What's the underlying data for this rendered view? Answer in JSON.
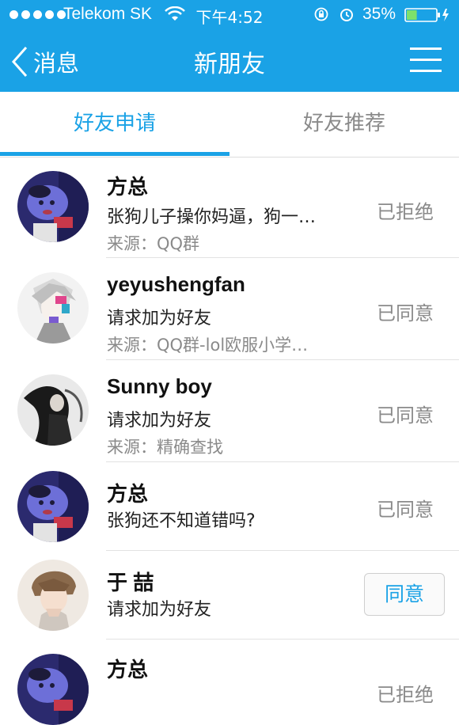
{
  "status_bar": {
    "carrier": "Telekom SK",
    "time": "下午4:52",
    "battery": "35%",
    "battery_level": 0.35
  },
  "nav": {
    "back_label": "消息",
    "title": "新朋友"
  },
  "tabs": [
    {
      "label": "好友申请",
      "active": true
    },
    {
      "label": "好友推荐",
      "active": false
    }
  ],
  "requests": [
    {
      "name": "方总",
      "message": "张狗儿子操你妈逼，狗一…",
      "source": "来源：QQ群",
      "status": "已拒绝",
      "avatar": "crayon-shin-chan-avatar"
    },
    {
      "name": "yeyushengfan",
      "message": "请求加为好友",
      "source": "来源：QQ群-lol欧服小学…",
      "status": "已同意",
      "avatar": "anime-sketch-avatar"
    },
    {
      "name": "Sunny boy",
      "message": "请求加为好友",
      "source": "来源：精确查找",
      "status": "已同意",
      "avatar": "ink-figure-avatar"
    },
    {
      "name": "方总",
      "message": "张狗还不知道错吗?",
      "source": "",
      "status": "已同意",
      "avatar": "crayon-shin-chan-avatar"
    },
    {
      "name": "于  喆",
      "message": "请求加为好友",
      "source": "",
      "status": "",
      "action": "同意",
      "avatar": "anime-boy-avatar"
    },
    {
      "name": "方总",
      "message": "",
      "source": "",
      "status": "已拒绝",
      "avatar": "crayon-shin-chan-avatar"
    }
  ],
  "colors": {
    "accent": "#1aa2e6",
    "muted_text": "#8a8a8a",
    "divider": "#e2e2e2"
  }
}
